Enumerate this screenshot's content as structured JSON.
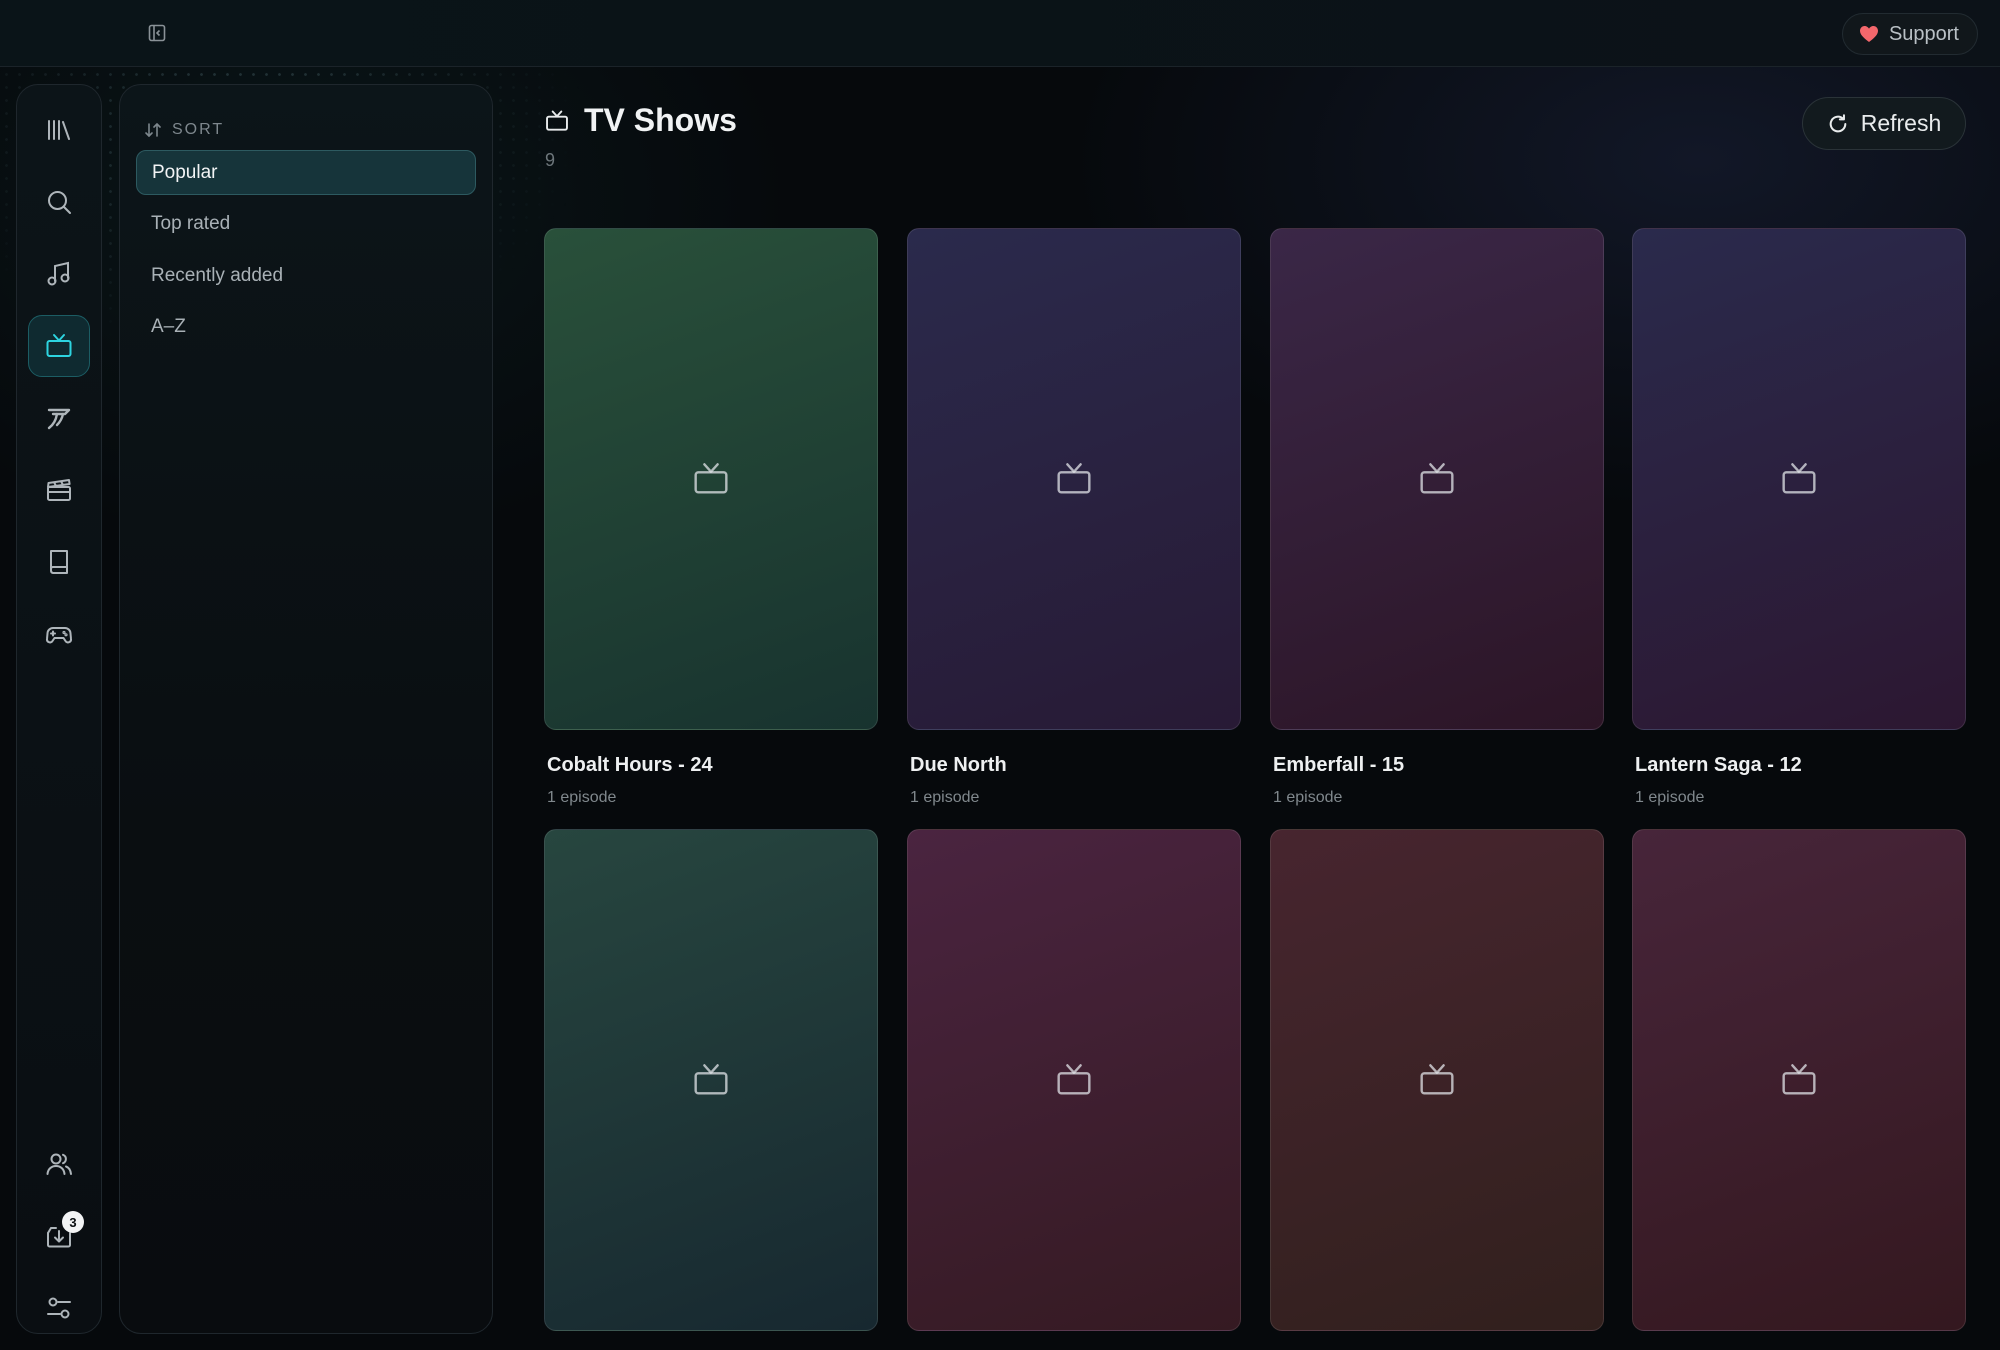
{
  "topbar": {
    "support_label": "Support",
    "accent_heart": "#f4676c"
  },
  "rail": {
    "items": [
      {
        "name": "library",
        "icon": "library-icon"
      },
      {
        "name": "search",
        "icon": "search-icon"
      },
      {
        "name": "music",
        "icon": "music-icon"
      },
      {
        "name": "tv",
        "icon": "tv-icon",
        "active": true
      },
      {
        "name": "anime",
        "icon": "brush-icon"
      },
      {
        "name": "movies",
        "icon": "clapperboard-icon"
      },
      {
        "name": "books",
        "icon": "book-icon"
      },
      {
        "name": "games",
        "icon": "gamepad-icon"
      },
      {
        "name": "users",
        "icon": "users-icon"
      },
      {
        "name": "downloads",
        "icon": "download-icon",
        "badge": "3"
      },
      {
        "name": "settings",
        "icon": "sliders-icon"
      }
    ],
    "downloads_badge": "3",
    "accent": "#2dd4e0"
  },
  "sort": {
    "header": "SORT",
    "options": [
      "Popular",
      "Top rated",
      "Recently added",
      "A–Z"
    ],
    "selected": "Popular"
  },
  "main": {
    "title": "TV Shows",
    "count": "9",
    "refresh_label": "Refresh",
    "shows": [
      {
        "title": "Cobalt Hours - 24",
        "subtitle": "1 episode",
        "color_top": "#29503a",
        "color_bottom": "#18332f"
      },
      {
        "title": "Due North",
        "subtitle": "1 episode",
        "color_top": "#2a2a4c",
        "color_bottom": "#281a35"
      },
      {
        "title": "Emberfall - 15",
        "subtitle": "1 episode",
        "color_top": "#3a2747",
        "color_bottom": "#2c1526"
      },
      {
        "title": "Lantern Saga - 12",
        "subtitle": "1 episode",
        "color_top": "#2a2a4c",
        "color_bottom": "#2c1731"
      },
      {
        "title": "",
        "subtitle": "",
        "color_top": "#27463f",
        "color_bottom": "#172830"
      },
      {
        "title": "",
        "subtitle": "",
        "color_top": "#4a2440",
        "color_bottom": "#351a22"
      },
      {
        "title": "",
        "subtitle": "",
        "color_top": "#47252f",
        "color_bottom": "#31201d"
      },
      {
        "title": "",
        "subtitle": "",
        "color_top": "#47253a",
        "color_bottom": "#34181f"
      }
    ]
  }
}
